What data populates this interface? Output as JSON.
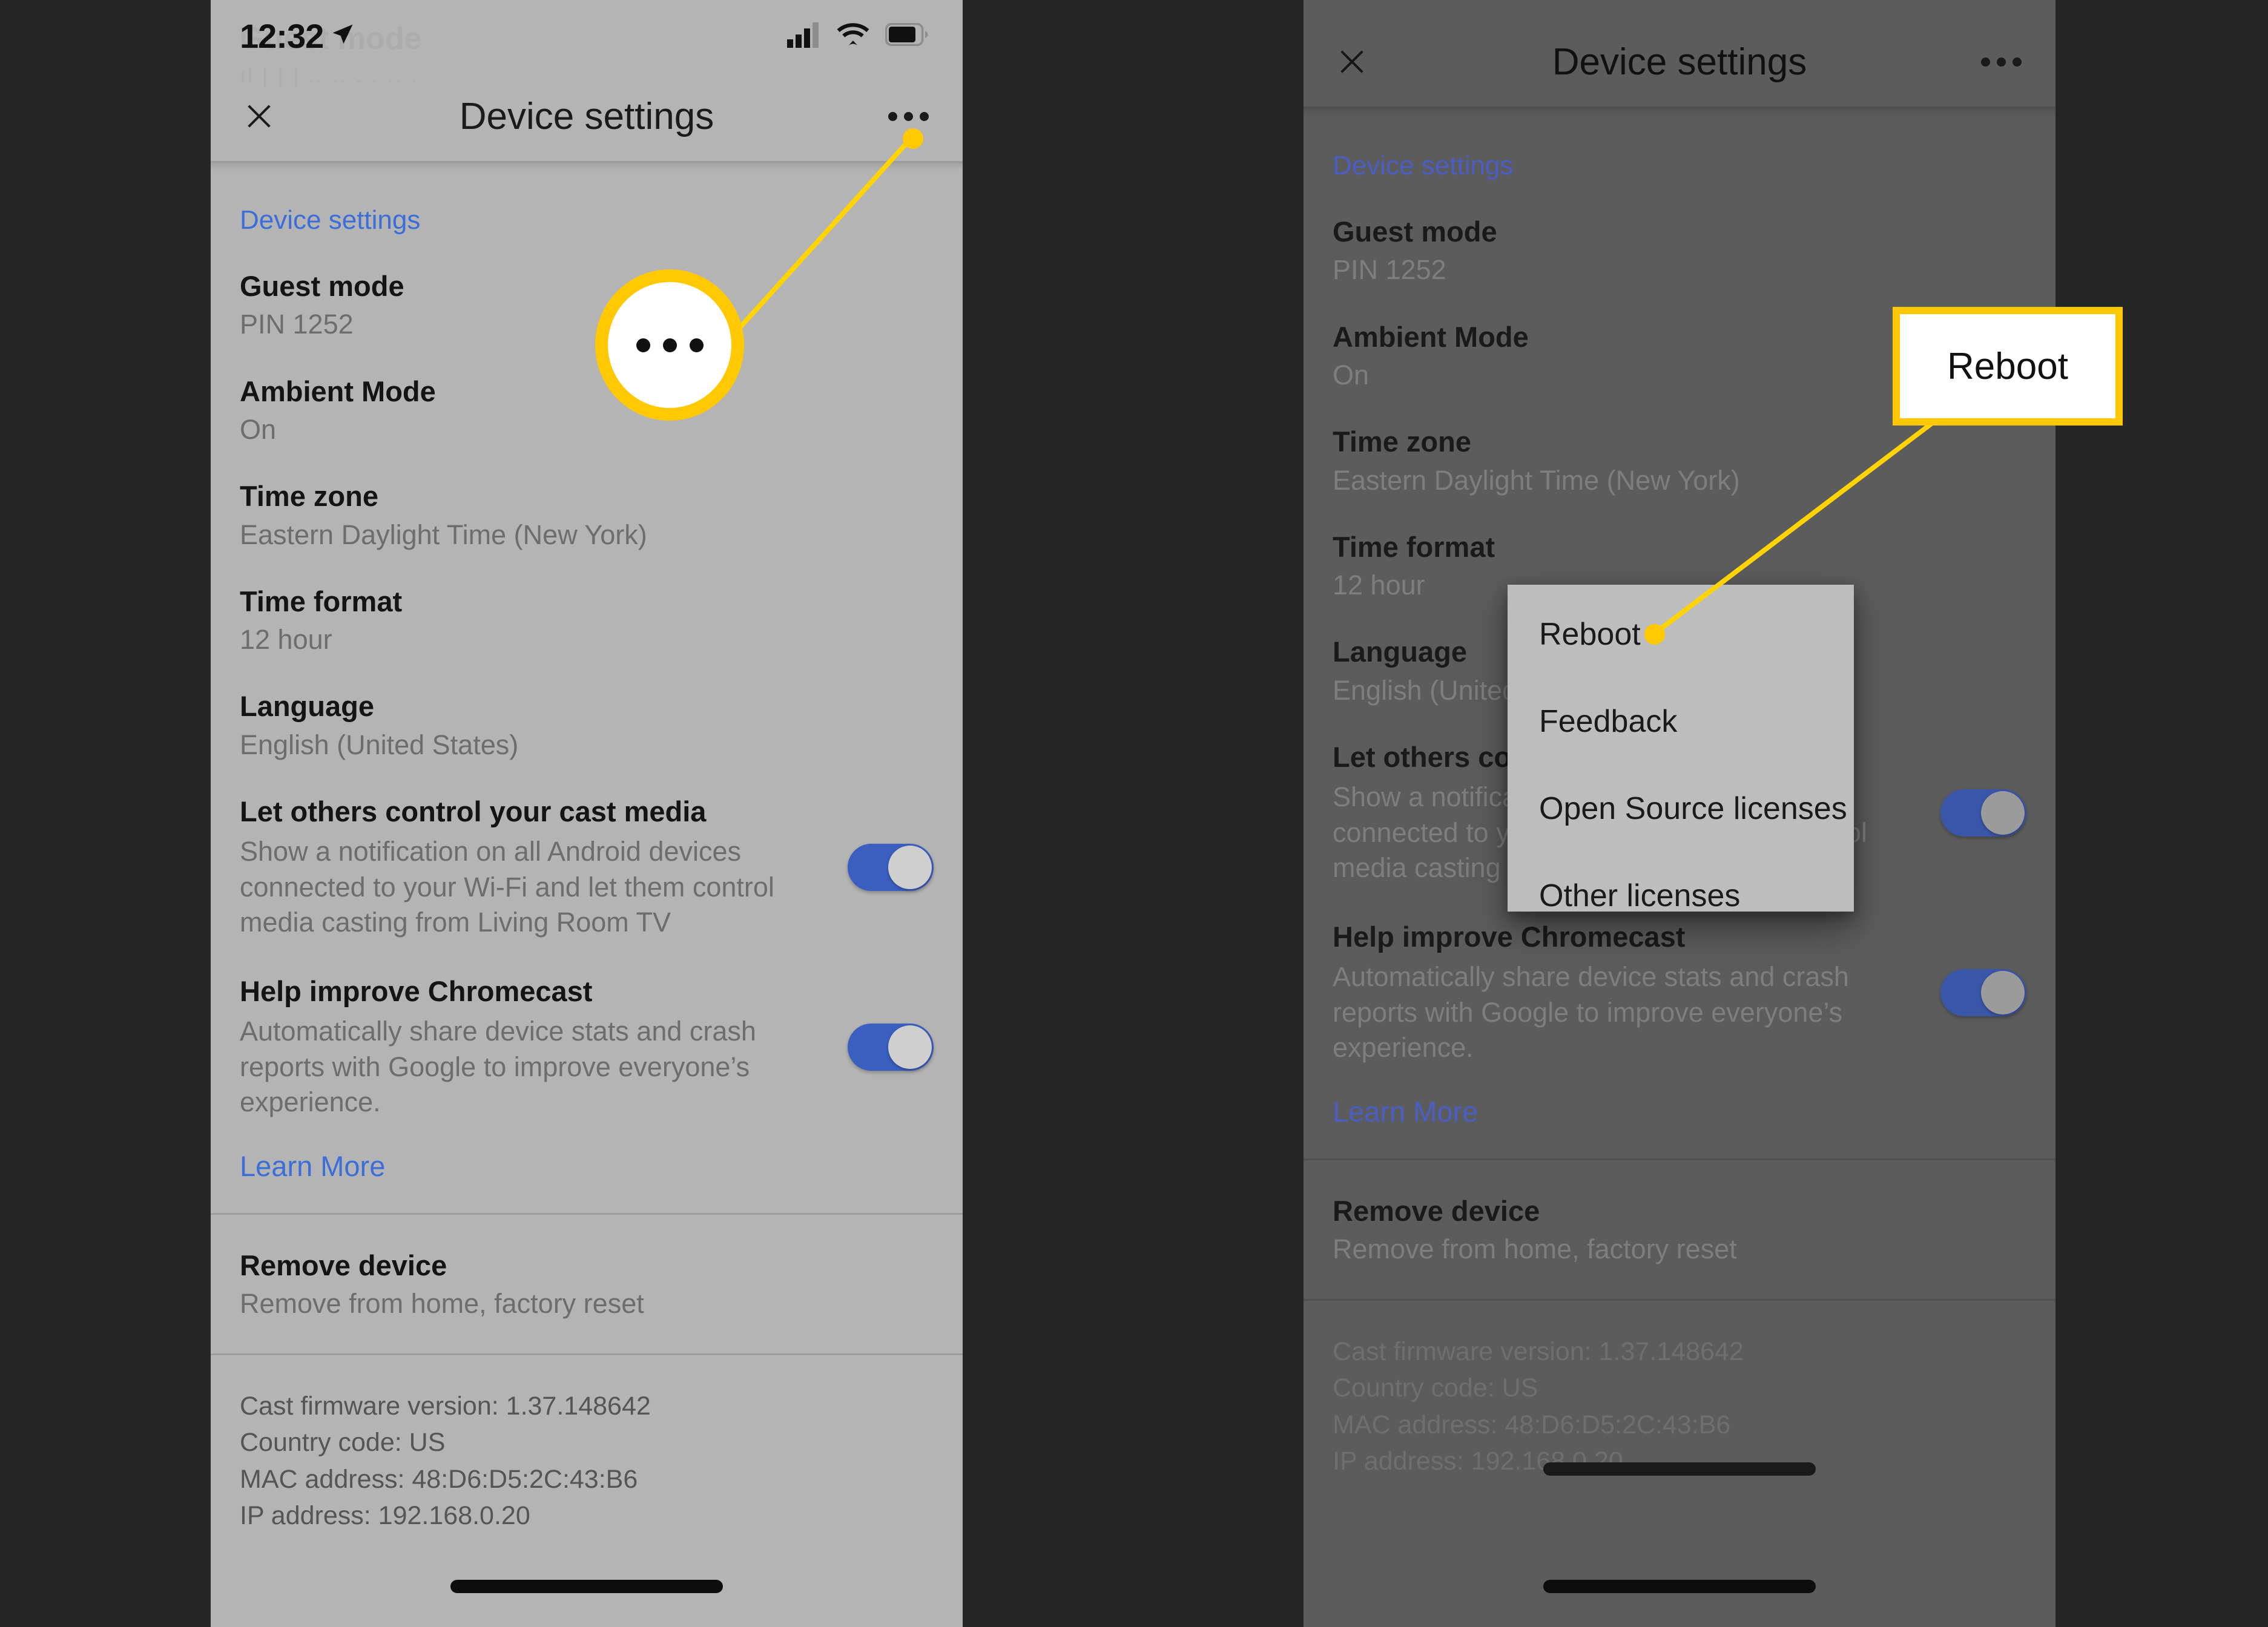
{
  "status_bar": {
    "time": "12:32",
    "location_icon": "location-arrow-icon",
    "cellular_icon": "cellular-bars-icon",
    "wifi_icon": "wifi-icon",
    "battery_icon": "battery-icon",
    "ghost_text": "Guest mode",
    "ghost_text_2": "ıl | | | ..  ..  .  .  ..  ."
  },
  "app_bar": {
    "close_label": "✕",
    "title": "Device settings",
    "overflow_label": "overflow-menu"
  },
  "section": {
    "header": "Device settings"
  },
  "settings": [
    {
      "title": "Guest mode",
      "sub": "PIN 1252"
    },
    {
      "title": "Ambient Mode",
      "sub": "On"
    },
    {
      "title": "Time zone",
      "sub": "Eastern Daylight Time (New York)"
    },
    {
      "title": "Time format",
      "sub": "12 hour"
    },
    {
      "title": "Language",
      "sub": "English (United States)"
    }
  ],
  "toggles": [
    {
      "title": "Let others control your cast media",
      "desc": "Show a notification on all Android devices connected to your Wi-Fi and let them control media casting from Living Room TV",
      "state": "on"
    },
    {
      "title": "Help improve Chromecast",
      "desc": "Automatically share device stats and crash reports with Google to improve everyone’s experience.",
      "state": "on"
    }
  ],
  "learn_more": "Learn More",
  "remove_device": {
    "title": "Remove device",
    "sub": "Remove from home, factory reset"
  },
  "device_info": [
    "Cast firmware version: 1.37.148642",
    "Country code: US",
    "MAC address: 48:D6:D5:2C:43:B6",
    "IP address: 192.168.0.20"
  ],
  "overflow_menu": {
    "items": [
      "Reboot",
      "Feedback",
      "Open Source licenses",
      "Other licenses"
    ]
  },
  "annotations": {
    "left_callout_icon": "overflow-dots-icon",
    "right_callout_label": "Reboot"
  },
  "colors": {
    "highlight": "#ffc800",
    "link": "#3b6ed8",
    "toggle_on": "#3b5fc0",
    "panel_bg": "#b4b4b4",
    "panel_bg_dim": "#5c5c5c",
    "page_bg": "#262626"
  }
}
